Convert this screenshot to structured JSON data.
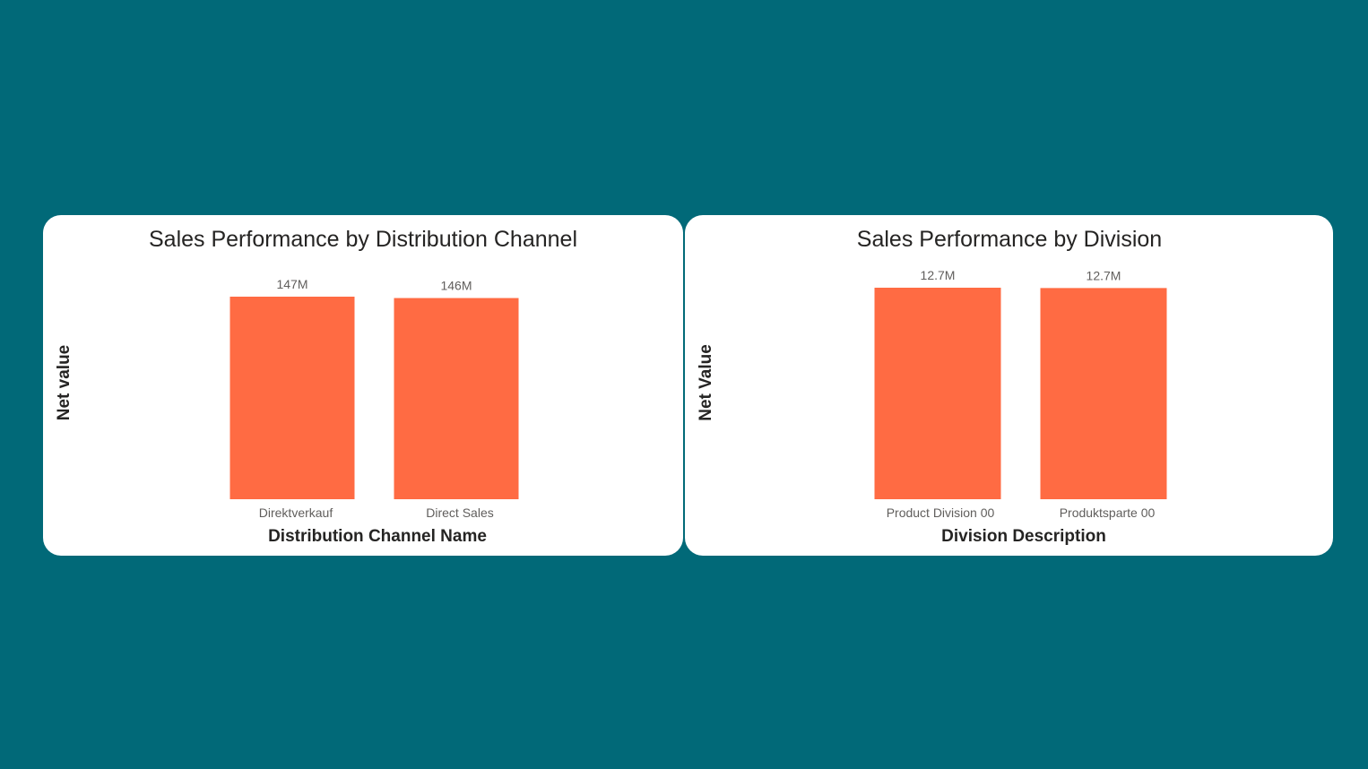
{
  "colors": {
    "page_background": "#016978",
    "card_background": "#ffffff",
    "bar": "#FF6B43",
    "title_text": "#252423",
    "label_text": "#605e5c"
  },
  "chart_data": [
    {
      "type": "bar",
      "title": "Sales Performance by Distribution Channel",
      "xlabel": "Distribution Channel Name",
      "ylabel": "Net value",
      "categories": [
        "Direktverkauf",
        "Direct Sales"
      ],
      "values": [
        147000000,
        146000000
      ],
      "data_labels": [
        "147M",
        "146M"
      ],
      "ylim": [
        0,
        147000000
      ],
      "grid": false,
      "legend": "none"
    },
    {
      "type": "bar",
      "title": "Sales Performance by Division",
      "xlabel": "Division Description",
      "ylabel": "Net Value",
      "categories": [
        "Product Division 00",
        "Produktsparte 00"
      ],
      "values": [
        12700000,
        12680000
      ],
      "data_labels": [
        "12.7M",
        "12.7M"
      ],
      "ylim": [
        0,
        12700000
      ],
      "grid": false,
      "legend": "none"
    }
  ]
}
